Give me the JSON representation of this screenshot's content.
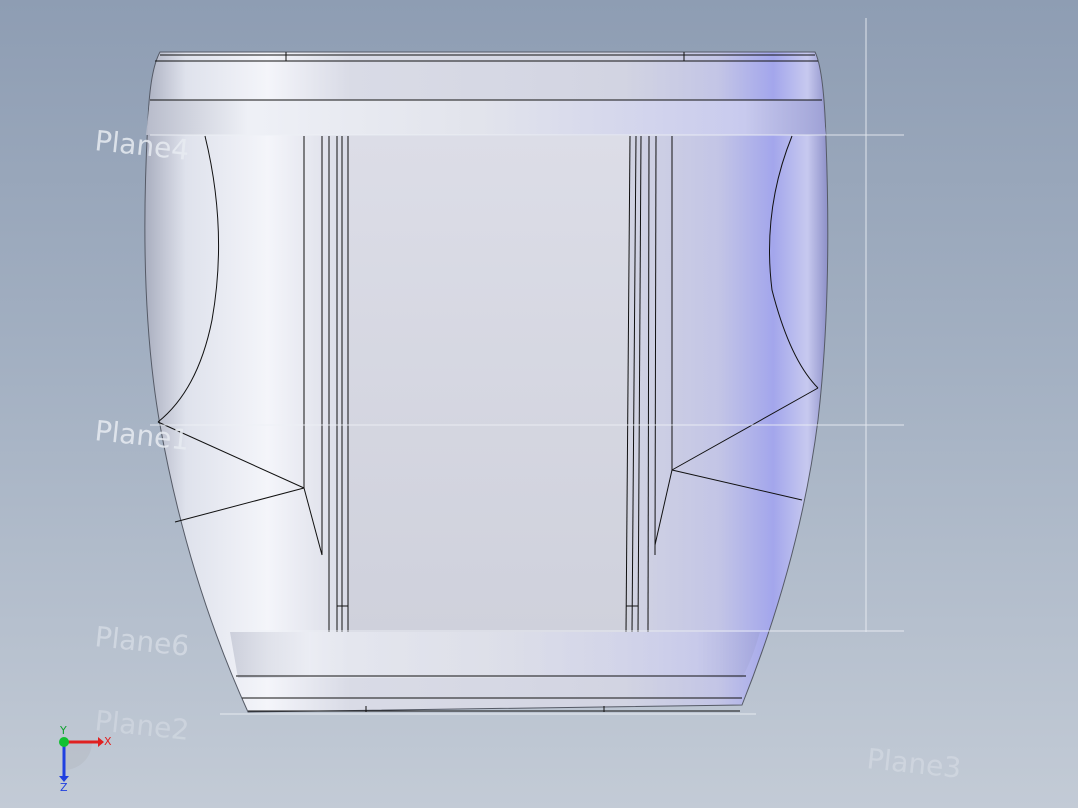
{
  "planes": {
    "plane4": "Plane4",
    "plane1": "Plane1",
    "plane6": "Plane6",
    "plane2": "Plane2",
    "plane3": "Plane3"
  },
  "triad": {
    "x": "X",
    "y": "Y",
    "z": "Z",
    "x_color": "#e02020",
    "y_color": "#10c030",
    "z_color": "#2040e0"
  },
  "model": {
    "body_color": "#d4d8e8",
    "edge_color": "#000000",
    "highlight_color": "#9fa3e8"
  }
}
